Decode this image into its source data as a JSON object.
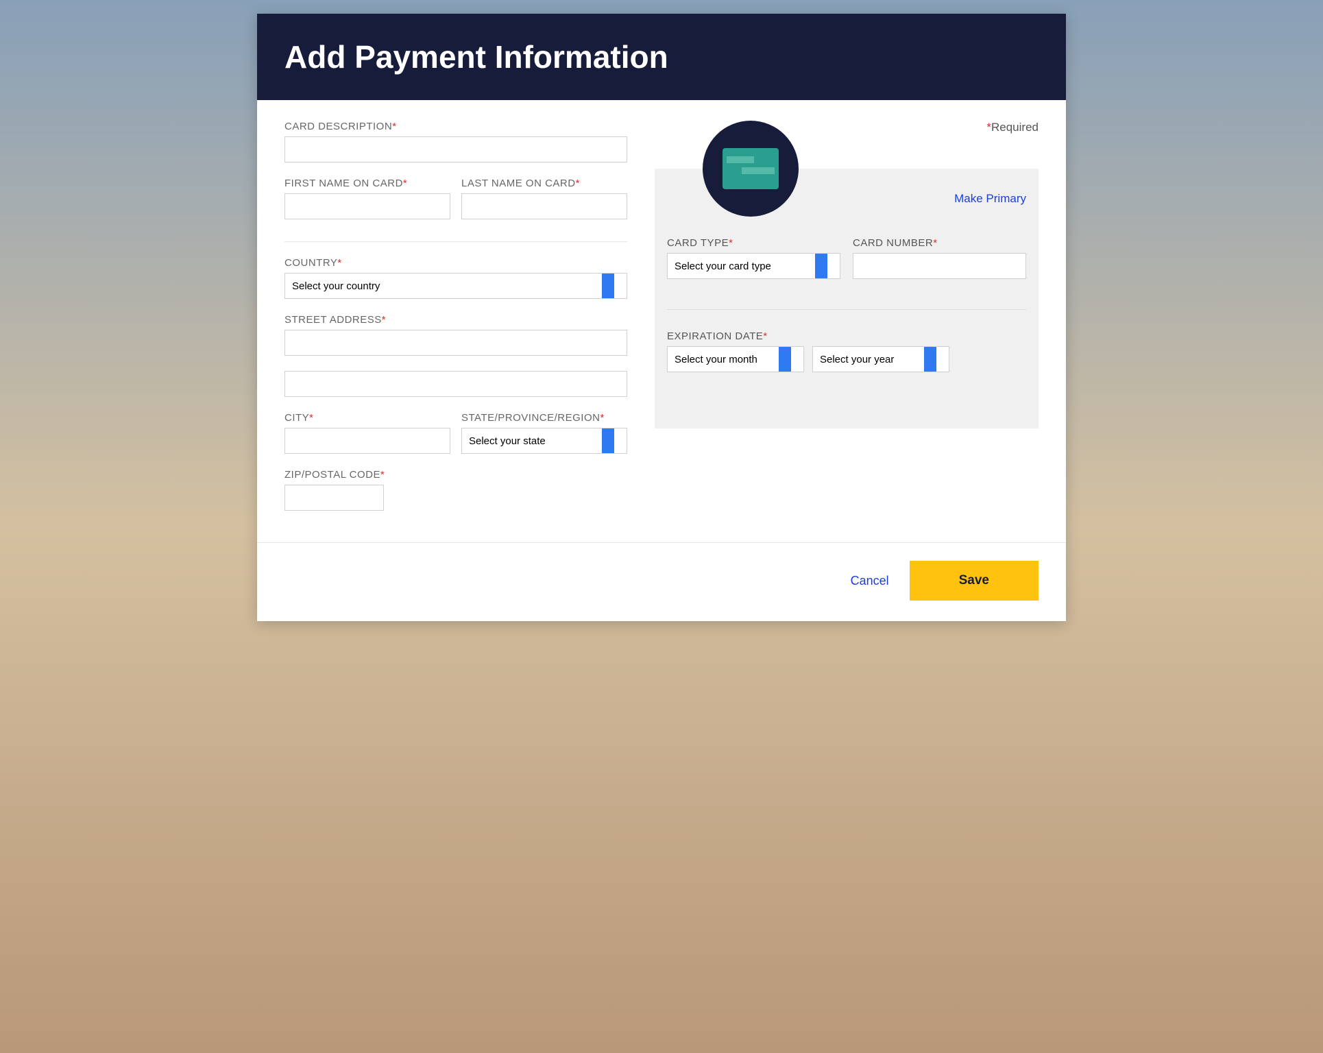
{
  "header": {
    "title": "Add Payment Information"
  },
  "required_label": "Required",
  "left": {
    "card_description_label": "CARD DESCRIPTION",
    "first_name_label": "FIRST NAME ON CARD",
    "last_name_label": "LAST NAME ON CARD",
    "country_label": "COUNTRY",
    "country_placeholder": "Select your country",
    "street_label": "STREET ADDRESS",
    "city_label": "CITY",
    "state_label": "STATE/PROVINCE/REGION",
    "state_placeholder": "Select your state",
    "zip_label": "ZIP/POSTAL CODE"
  },
  "card": {
    "make_primary_label": "Make Primary",
    "card_type_label": "CARD TYPE",
    "card_type_placeholder": "Select your card type",
    "card_number_label": "CARD NUMBER",
    "expiration_label": "EXPIRATION DATE",
    "month_placeholder": "Select your month",
    "year_placeholder": "Select your year"
  },
  "footer": {
    "cancel_label": "Cancel",
    "save_label": "Save"
  }
}
